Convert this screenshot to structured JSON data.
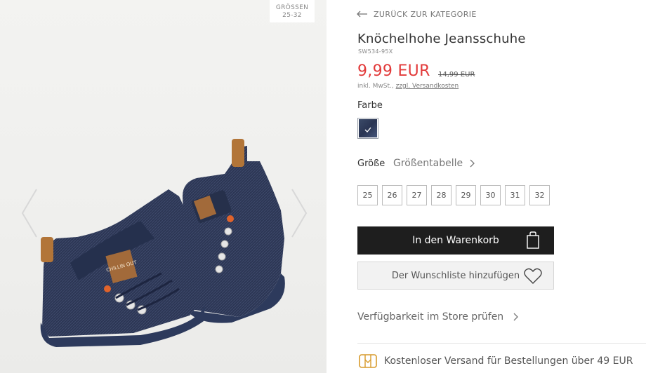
{
  "gallery": {
    "size_badge_line1": "GRÖSSEN",
    "size_badge_line2": "25-32"
  },
  "nav": {
    "back_label": "ZURÜCK ZUR KATEGORIE"
  },
  "product": {
    "title": "Knöchelhohe Jeansschuhe",
    "sku": "SW534-95X",
    "price": "9,99 EUR",
    "old_price": "14,99 EUR",
    "vat_text": "inkl. MwSt.,",
    "shipping_link": "zzgl. Versandkosten",
    "shoe_tag_text": "CHILLIN OUT"
  },
  "color": {
    "label": "Farbe",
    "selected_swatch": "#2f3b5a"
  },
  "size": {
    "label": "Größe",
    "chart_label": "Größentabelle",
    "options": [
      "25",
      "26",
      "27",
      "28",
      "29",
      "30",
      "31",
      "32"
    ]
  },
  "actions": {
    "add_to_cart": "In den Warenkorb",
    "add_to_wishlist": "Der Wunschliste hinzufügen",
    "store_check": "Verfügbarkeit im Store prüfen"
  },
  "shipping_info": {
    "text": "Kostenloser Versand für Bestellungen über 49 EUR"
  },
  "colors": {
    "price_red": "#e23a3a",
    "cart_bg": "#1e1e1e",
    "shipping_icon": "#d79a2b"
  },
  "icons": {
    "back": "arrow-left-icon",
    "gallery_prev": "chevron-left-icon",
    "gallery_next": "chevron-right-icon",
    "cart": "shopping-bag-icon",
    "wishlist": "heart-icon",
    "shipping": "delivery-truck-icon"
  }
}
